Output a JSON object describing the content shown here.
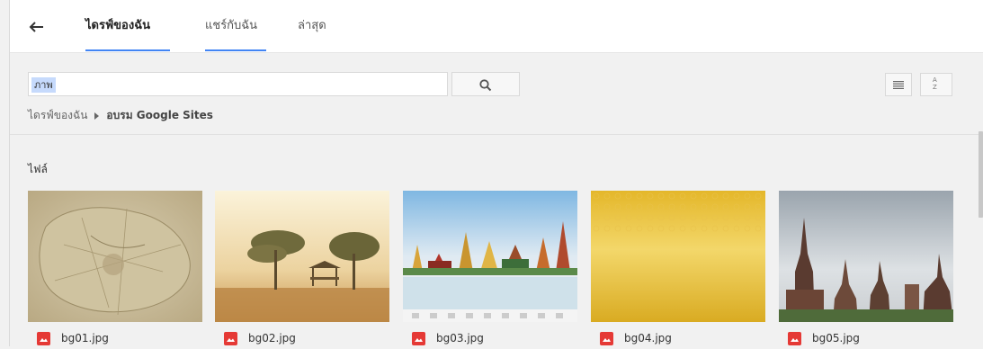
{
  "tabs": [
    {
      "label": "ไดรฟ์ของฉัน",
      "active": true
    },
    {
      "label": "แชร์กับฉัน",
      "active": false
    },
    {
      "label": "ล่าสุด",
      "active": false
    }
  ],
  "search": {
    "value": "ภาพ"
  },
  "sort_icon": {
    "top": "A",
    "bottom": "Z"
  },
  "breadcrumb": {
    "root": "ไดรฟ์ของฉัน",
    "current": "อบรม Google Sites"
  },
  "section_title": "ไฟล์",
  "files": [
    {
      "name": "bg01.jpg"
    },
    {
      "name": "bg02.jpg"
    },
    {
      "name": "bg03.jpg"
    },
    {
      "name": "bg04.jpg"
    },
    {
      "name": "bg05.jpg"
    }
  ],
  "colors": {
    "accent": "#4285f4",
    "image_icon": "#e53935"
  },
  "icons": [
    "back-arrow-icon",
    "search-icon",
    "list-view-icon",
    "sort-az-icon",
    "image-file-icon"
  ]
}
